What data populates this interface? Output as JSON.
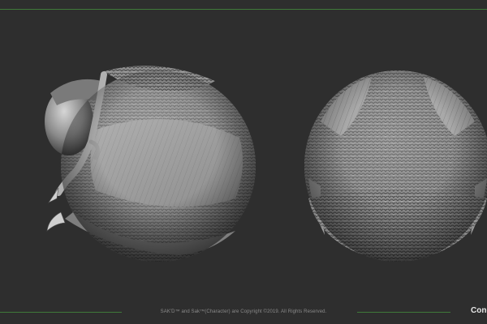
{
  "footer": {
    "copyright": "SAK'D™ and Sak™(Character) are Copyright ©2019. All Rights Reserved.",
    "brand": "Cone"
  },
  "colors": {
    "background": "#2e2e2e",
    "accent_line": "#3f7a3a",
    "sculpt_base": "#9a9a9a"
  }
}
